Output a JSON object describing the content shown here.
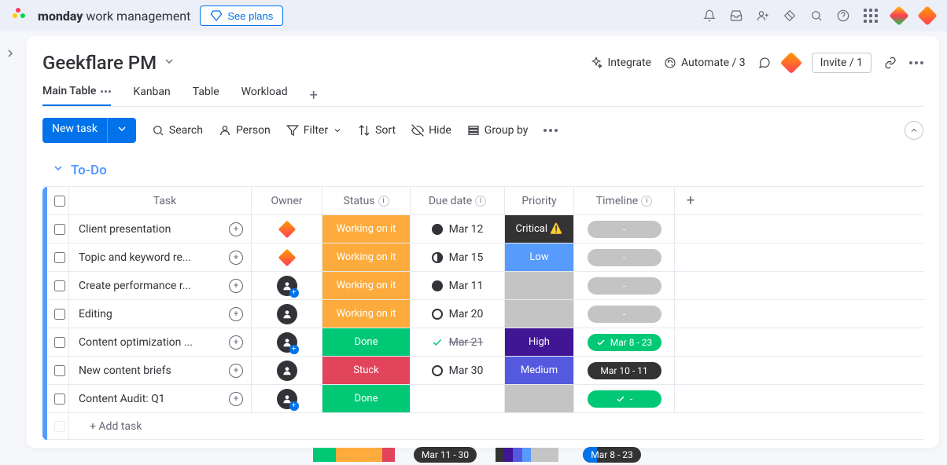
{
  "topbar": {
    "product_bold": "monday",
    "product_rest": " work management",
    "see_plans": "See plans"
  },
  "header": {
    "title": "Geekflare PM",
    "integrate": "Integrate",
    "automate": "Automate / 3",
    "invite": "Invite / 1"
  },
  "tabs": [
    "Main Table",
    "Kanban",
    "Table",
    "Workload"
  ],
  "toolbar": {
    "new_task": "New task",
    "search": "Search",
    "person": "Person",
    "filter": "Filter",
    "sort": "Sort",
    "hide": "Hide",
    "group_by": "Group by"
  },
  "group": {
    "name": "To-Do"
  },
  "columns": {
    "task": "Task",
    "owner": "Owner",
    "status": "Status",
    "due": "Due date",
    "priority": "Priority",
    "timeline": "Timeline"
  },
  "rows": [
    {
      "task": "Client presentation",
      "owner": "diamond",
      "status": "Working on it",
      "status_cls": "s-working",
      "due": "Mar 12",
      "due_icon": "full",
      "priority": "Critical ⚠️",
      "priority_cls": "p-critical",
      "timeline": "-",
      "tl_cls": "tl-empty"
    },
    {
      "task": "Topic and keyword re...",
      "owner": "diamond",
      "status": "Working on it",
      "status_cls": "s-working",
      "due": "Mar 15",
      "due_icon": "half",
      "priority": "Low",
      "priority_cls": "p-low",
      "timeline": "-",
      "tl_cls": "tl-empty"
    },
    {
      "task": "Create performance r...",
      "owner": "person-plus",
      "status": "Working on it",
      "status_cls": "s-working",
      "due": "Mar 11",
      "due_icon": "full",
      "priority": "",
      "priority_cls": "s-empty",
      "timeline": "-",
      "tl_cls": "tl-empty"
    },
    {
      "task": "Editing",
      "owner": "person",
      "status": "Working on it",
      "status_cls": "s-working",
      "due": "Mar 20",
      "due_icon": "empty",
      "priority": "",
      "priority_cls": "s-empty",
      "timeline": "-",
      "tl_cls": "tl-empty"
    },
    {
      "task": "Content optimization ...",
      "owner": "person-plus",
      "status": "Done",
      "status_cls": "s-done",
      "due": "Mar 21",
      "due_icon": "check",
      "due_strike": true,
      "priority": "High",
      "priority_cls": "p-high",
      "timeline": "Mar 8 - 23",
      "tl_cls": "tl-green",
      "tl_check": true
    },
    {
      "task": "New content briefs",
      "owner": "person",
      "status": "Stuck",
      "status_cls": "s-stuck",
      "due": "Mar 30",
      "due_icon": "empty",
      "priority": "Medium",
      "priority_cls": "p-medium",
      "timeline": "Mar 10 - 11",
      "tl_cls": "tl-dark"
    },
    {
      "task": "Content Audit: Q1",
      "owner": "person-plus",
      "status": "Done",
      "status_cls": "s-done",
      "due": "",
      "due_icon": "",
      "priority": "",
      "priority_cls": "s-empty",
      "timeline": "-",
      "tl_cls": "tl-green",
      "tl_check": true
    }
  ],
  "add_task": "+ Add task",
  "summary": {
    "due": "Mar 11 - 30",
    "timeline": "Mar 8 - 23",
    "status_segs": [
      {
        "c": "#00c875",
        "w": "28%"
      },
      {
        "c": "#fdab3d",
        "w": "57%"
      },
      {
        "c": "#e2445c",
        "w": "15%"
      }
    ],
    "priority_segs": [
      {
        "c": "#333",
        "w": "14%"
      },
      {
        "c": "#401694",
        "w": "14%"
      },
      {
        "c": "#5559df",
        "w": "14%"
      },
      {
        "c": "#579bfc",
        "w": "14%"
      },
      {
        "c": "#c4c4c4",
        "w": "44%"
      }
    ]
  }
}
